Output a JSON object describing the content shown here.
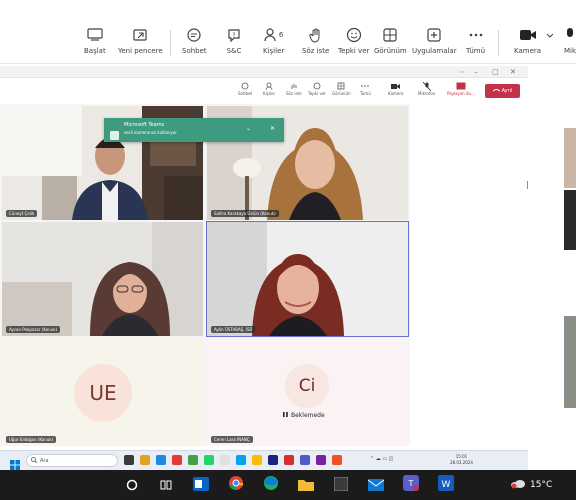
{
  "toolbar": {
    "baslat": "Başlat",
    "yeni_pencere": "Yeni pencere",
    "sohbet": "Sohbet",
    "sc": "S&C",
    "kisiler": "Kişiler",
    "kisiler_count": "6",
    "soz_iste": "Söz iste",
    "tepki_ver": "Tepki ver",
    "gorunum": "Görünüm",
    "uygulamalar": "Uygulamalar",
    "tumu": "Tümü",
    "kamera": "Kamera",
    "mikrofon_partial": "Mik"
  },
  "inner_toolbar": {
    "sohbet": "Sohbet",
    "kisiler": "Kişiler",
    "soz_iste": "Söz iste",
    "tepki_ver": "Tepki ver",
    "gorunum": "Görünüm",
    "tumu": "Tümü",
    "kamera": "Kamera",
    "mikrofon": "Mikrofon",
    "paylasim": "Paylaşım du...",
    "leave": "Ayrıl"
  },
  "toast": {
    "title": "Microsoft Teams",
    "text": "sesli kameranızı kullanıyor"
  },
  "participants": [
    {
      "name": "Cüneyt Çelik",
      "type": "video"
    },
    {
      "name": "Saliha Karakaya Üstün (Konuk)",
      "type": "video"
    },
    {
      "name": "Aycan Pekpazar (Konuk)",
      "type": "video"
    },
    {
      "name": "Aylin ÜSTABAŞ, İSÜ",
      "type": "video",
      "active": true
    },
    {
      "name": "Uğur Erdoğan (Konuk)",
      "type": "avatar",
      "initials": "UE"
    },
    {
      "name": "Ceren Lara İNANÇ",
      "type": "avatar",
      "initials": "Ci",
      "status": "Beklemede"
    }
  ],
  "taskbar_search": {
    "placeholder": "Ara"
  },
  "system": {
    "temperature": "15°C",
    "time": "15:01",
    "date": "28.03.2024"
  },
  "colors": {
    "leave": "#c4314b",
    "toast": "#3e9b7f",
    "avatar_ue": "#f9e2d9",
    "avatar_ci": "#f8e6e2",
    "active_border": "#6b6fd4"
  }
}
